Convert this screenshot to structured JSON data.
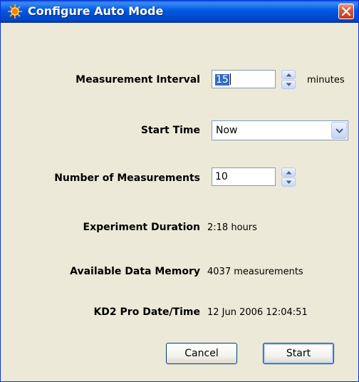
{
  "window": {
    "title": "Configure Auto Mode",
    "icon": "sun-burst-icon"
  },
  "form": {
    "interval": {
      "label": "Measurement Interval",
      "value": "15",
      "unit": "minutes"
    },
    "start_time": {
      "label": "Start Time",
      "value": "Now"
    },
    "count": {
      "label": "Number of Measurements",
      "value": "10"
    },
    "duration": {
      "label": "Experiment Duration",
      "value": "2:18 hours"
    },
    "memory": {
      "label": "Available Data Memory",
      "value": "4037 measurements"
    },
    "datetime": {
      "label": "KD2 Pro Date/Time",
      "value": "12 Jun 2006 12:04:51"
    }
  },
  "buttons": {
    "cancel": "Cancel",
    "start": "Start"
  },
  "colors": {
    "titlebar": "#0058e6",
    "window_bg": "#ece9d8",
    "selection": "#316ac5",
    "close": "#d9583a"
  }
}
